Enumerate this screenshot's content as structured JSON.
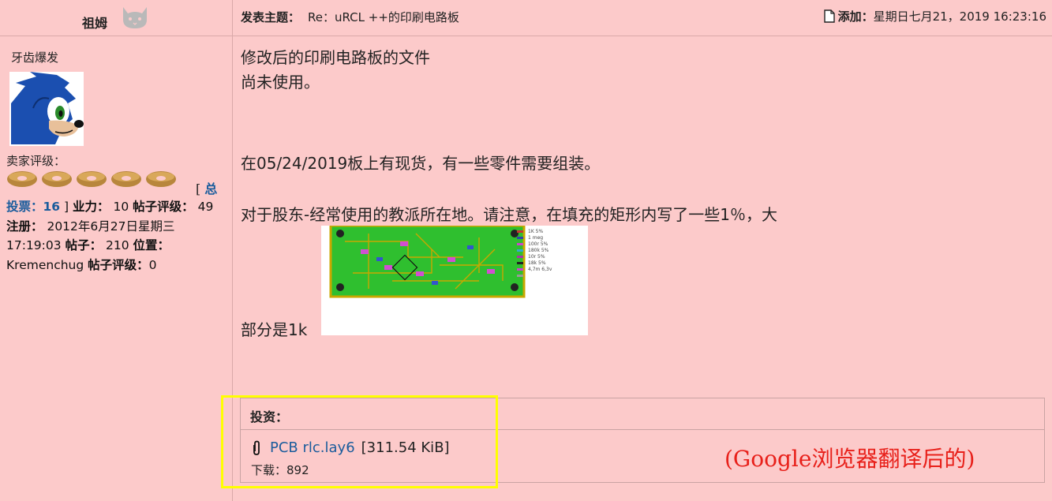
{
  "author": {
    "name": "祖姆",
    "rank": "牙齿爆发",
    "seller_label": "卖家评级："
  },
  "profile": {
    "summary_prefix": "[",
    "summary_link": "总",
    "votes_label": "投票：",
    "votes_value": "16",
    "votes_suffix": "]",
    "karma_label": "业力：",
    "karma_value": "10",
    "post_rating_label": "帖子评级：",
    "post_rating_value": "49",
    "registered_label": "注册：",
    "registered_value": "2012年6月27日星期三17:19:03",
    "posts_label": "帖子：",
    "posts_value": "210",
    "location_label": "位置：",
    "location_value": "Kremenchug",
    "post_grade_label": "帖子评级：",
    "post_grade_value": "0"
  },
  "header": {
    "subject_label": "发表主题：",
    "subject_value": "Re：uRCL ++的印刷电路板",
    "added_label": "添加：",
    "added_value": "星期日七月21，2019 16:23:16"
  },
  "post": {
    "line1": "修改后的印刷电路板的文件",
    "line2": "尚未使用。",
    "line3": "在05/24/2019板上有现货，有一些零件需要组装。",
    "line4": "对于股东-经常使用的教派所在地。请注意，在填充的矩形内写了一些1％，大",
    "line5": "部分是1k"
  },
  "pcb_legend": [
    "1K 5%",
    "1 meg",
    "100r 5%",
    "180k 5%",
    "10r 5%",
    "18k 5%",
    "4,7m 6,3v"
  ],
  "attachments": {
    "label": "投资：",
    "file_name": "PCB rlc.lay6",
    "file_size": "[311.54 KiB]",
    "downloads_label": "下载：",
    "downloads_value": "892"
  },
  "note": "(Google浏览器翻译后的)",
  "colors": {
    "background": "#fccaca",
    "link": "#1a5c9c",
    "note": "#e8201a",
    "highlight": "#ffff00"
  }
}
